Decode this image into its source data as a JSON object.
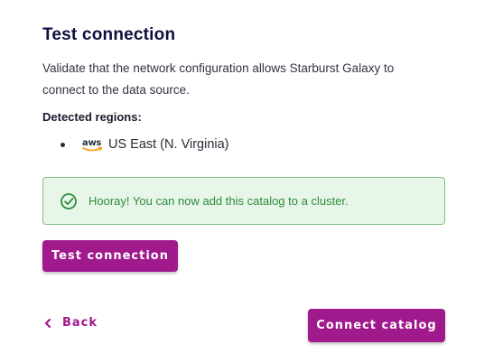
{
  "section": {
    "title": "Test connection",
    "description": "Validate that the network configuration allows Starburst Galaxy to connect to the data source.",
    "regions_label": "Detected regions:",
    "regions": [
      {
        "provider_icon": "aws-icon",
        "name": "US East (N. Virginia)"
      }
    ]
  },
  "status": {
    "message": "Hooray! You can now add this catalog to a cluster.",
    "icon": "check-circle-icon"
  },
  "actions": {
    "test_label": "Test connection",
    "back_label": "Back",
    "connect_label": "Connect catalog"
  },
  "colors": {
    "accent": "#a0198d",
    "success_bg": "#e8f6ea",
    "success_border": "#7cc47f",
    "success_text": "#2e8b3a"
  }
}
